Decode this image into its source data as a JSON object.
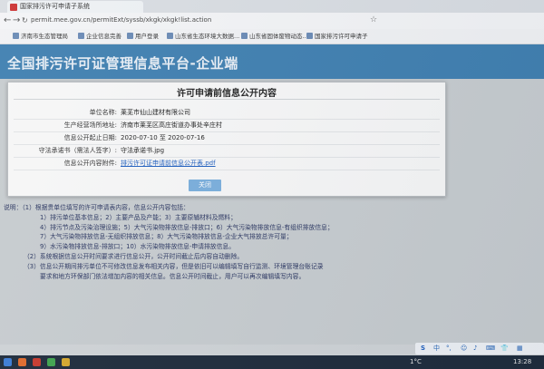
{
  "browser": {
    "tab_title": "国家排污许可申请子系统",
    "url": "permit.mee.gov.cn/permitExt/syssb/xkgk/xkgk!list.action",
    "bookmarks": [
      "济南市生态管理局",
      "企业信息完善",
      "用户登录",
      "山东省生态环境大数据...",
      "山东省固体废物动态...",
      "国家排污许可申请子"
    ]
  },
  "page": {
    "title": "全国排污许可证管理信息平台-企业端"
  },
  "modal": {
    "title": "许可申请前信息公开内容",
    "rows": [
      {
        "label": "单位名称:",
        "value": "莱芜市仙山建材有限公司"
      },
      {
        "label": "生产经营场所地址:",
        "value": "济南市莱芜区高庄街道办事处辛庄村"
      },
      {
        "label": "信息公开起止日期:",
        "value": "2020-07-10 至 2020-07-16"
      },
      {
        "label": "守法承诺书（需法人签字）:",
        "value": "守法承诺书.jpg"
      },
      {
        "label": "信息公开内容附件:",
        "value": "排污许可证申请前信息公开表.pdf"
      }
    ],
    "close_label": "关闭"
  },
  "notes": [
    "说明：（1）根据贵单位填写的许可申请表内容，信息公开内容包括：",
    "1）排污单位基本信息；2）主要产品及产能；3）主要原辅材料及燃料；",
    "4）排污节点及污染治理设施；5）大气污染物排放信息-排放口；6）大气污染物排放信息-有组织排放信息；",
    "7）大气污染物排放信息-无组织排放信息；8）大气污染物排放信息-企业大气排放总许可量；",
    "9）水污染物排放信息-排放口；10）水污染物排放信息-申请排放信息。",
    "（2）系统根据信息公开时间要求进行信息公开，公开时间截止后内容自动删除。",
    "（3）信息公开期间排污单位不可修改信息发布相关内容，但是依旧可以编辑填写自行监测、环境管理台账记录",
    "要求和地方环保部门依法增加内容的相关信息。信息公开时间截止，用户可以再次编辑填写内容。"
  ],
  "floatbar": {
    "text1": "中",
    "text2": "⌨",
    "text3": "👕"
  },
  "taskbar": {
    "weather": "1°C",
    "time": "13:28"
  }
}
